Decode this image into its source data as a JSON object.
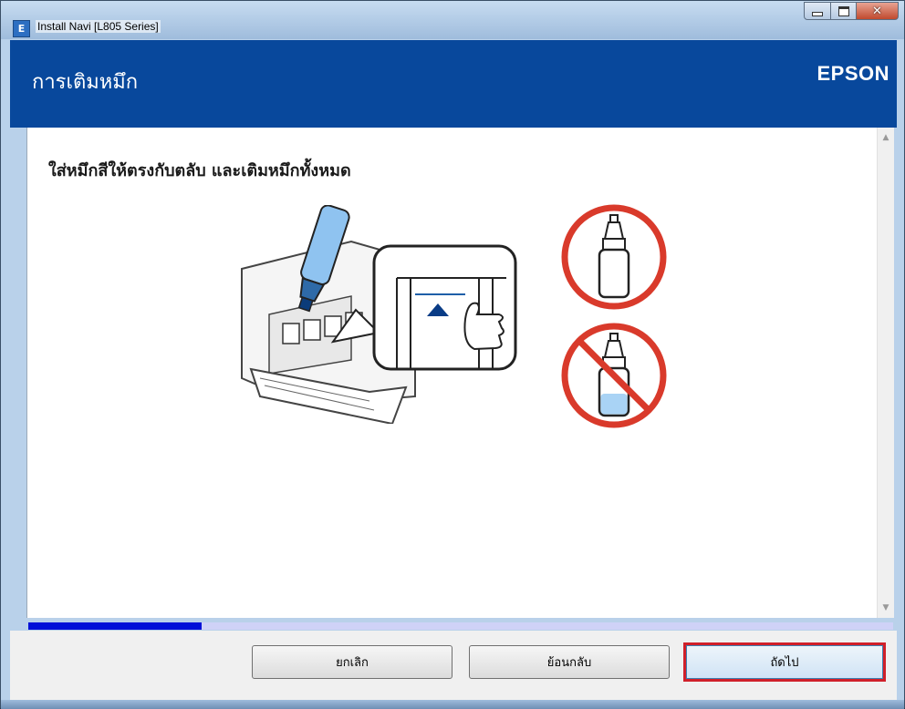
{
  "window": {
    "title": "Install Navi [L805 Series]",
    "app_icon_letter": "E"
  },
  "header": {
    "title": "การเติมหมึก",
    "brand": "EPSON",
    "background_color": "#08489c"
  },
  "content": {
    "instruction": "ใส่หมึกสีให้ตรงกับตลับ และเติมหมึกทั้งหมด",
    "icons": {
      "illustration": "printer-refill-illustration-icon",
      "correct": "full-ink-bottle-icon",
      "incorrect": "prohibited-partial-bottle-icon"
    }
  },
  "progress": {
    "fraction": 0.2,
    "fill_color": "#0010d8",
    "track_color": "#cfd2f7"
  },
  "footer": {
    "cancel_label": "ยกเลิก",
    "back_label": "ย้อนกลับ",
    "next_label": "ถัดไป",
    "highlight_color": "#d0202a"
  }
}
